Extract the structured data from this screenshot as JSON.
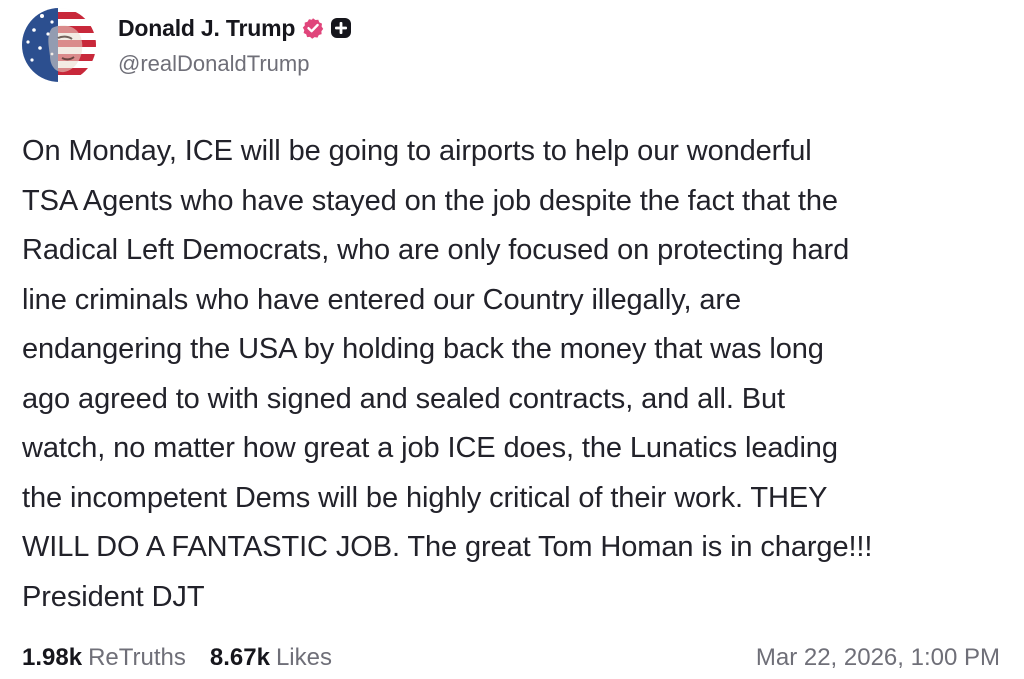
{
  "author": {
    "display_name": "Donald J. Trump",
    "handle": "@realDonaldTrump",
    "avatar_icon": "flag-portrait-avatar",
    "verified_icon": "verified-badge-icon",
    "verified_color": "#e0457b",
    "plus_icon": "plus-badge-icon"
  },
  "post": {
    "text": "On Monday, ICE will be going to airports to help our wonderful\nTSA Agents who have stayed on the job despite the fact that the\nRadical Left Democrats, who are only focused on protecting hard\nline criminals who have entered our Country illegally, are\nendangering the USA by holding back the money that was long\nago agreed to with signed and sealed contracts, and all. But\nwatch, no matter how great a job ICE does, the Lunatics leading\nthe incompetent Dems will be highly critical of their work. THEY\nWILL DO A FANTASTIC JOB. The great Tom Homan is in charge!!!\nPresident DJT"
  },
  "stats": {
    "retruths_count": "1.98k",
    "retruths_label": "ReTruths",
    "likes_count": "8.67k",
    "likes_label": "Likes",
    "timestamp": "Mar 22, 2026, 1:00 PM"
  }
}
